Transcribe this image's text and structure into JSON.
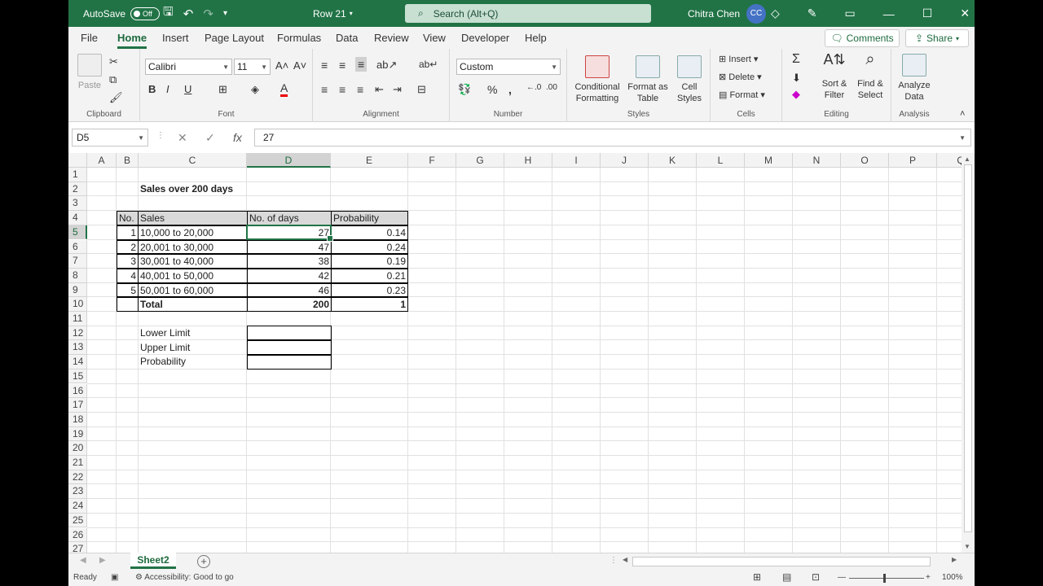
{
  "titlebar": {
    "autosave_label": "AutoSave",
    "autosave_state": "Off",
    "doc_title": "Row 21",
    "search_placeholder": "Search (Alt+Q)",
    "user_name": "Chitra Chen",
    "user_initials": "CC"
  },
  "tabs": [
    "File",
    "Home",
    "Insert",
    "Page Layout",
    "Formulas",
    "Data",
    "Review",
    "View",
    "Developer",
    "Help"
  ],
  "active_tab": "Home",
  "buttons": {
    "comments": "Comments",
    "share": "Share"
  },
  "ribbon": {
    "clipboard": {
      "paste": "Paste",
      "label": "Clipboard"
    },
    "font": {
      "name": "Calibri",
      "size": "11",
      "label": "Font"
    },
    "alignment": {
      "label": "Alignment"
    },
    "number": {
      "format": "Custom",
      "label": "Number"
    },
    "styles": {
      "conditional": "Conditional",
      "conditional2": "Formatting",
      "format_as": "Format as",
      "format_as2": "Table",
      "cell": "Cell",
      "cell2": "Styles",
      "label": "Styles"
    },
    "cells": {
      "insert": "Insert",
      "delete": "Delete",
      "format": "Format",
      "label": "Cells"
    },
    "editing": {
      "sort": "Sort &",
      "sort2": "Filter",
      "find": "Find &",
      "find2": "Select",
      "label": "Editing"
    },
    "analysis": {
      "analyze": "Analyze",
      "analyze2": "Data",
      "label": "Analysis"
    }
  },
  "formula_bar": {
    "name_box": "D5",
    "formula": "27"
  },
  "columns": [
    "A",
    "B",
    "C",
    "D",
    "E",
    "F",
    "G",
    "H",
    "I",
    "J",
    "K",
    "L",
    "M",
    "N",
    "O",
    "P",
    "Q"
  ],
  "rows": [
    "1",
    "2",
    "3",
    "4",
    "5",
    "6",
    "7",
    "8",
    "9",
    "10",
    "11",
    "12",
    "13",
    "14",
    "15",
    "16",
    "17",
    "18",
    "19",
    "20",
    "21",
    "22",
    "23",
    "24",
    "25",
    "26",
    "27"
  ],
  "sheet": {
    "title": "Sales over 200 days",
    "headers": {
      "no": "No.",
      "sales": "Sales",
      "days": "No. of days",
      "prob": "Probability"
    },
    "data": [
      {
        "no": "1",
        "sales": "10,000 to 20,000",
        "days": "27",
        "prob": "0.14"
      },
      {
        "no": "2",
        "sales": "20,001 to 30,000",
        "days": "47",
        "prob": "0.24"
      },
      {
        "no": "3",
        "sales": "30,001 to 40,000",
        "days": "38",
        "prob": "0.19"
      },
      {
        "no": "4",
        "sales": "40,001 to 50,000",
        "days": "42",
        "prob": "0.21"
      },
      {
        "no": "5",
        "sales": "50,001 to 60,000",
        "days": "46",
        "prob": "0.23"
      }
    ],
    "total": {
      "label": "Total",
      "days": "200",
      "prob": "1"
    },
    "lower_limit": "Lower Limit",
    "upper_limit": "Upper Limit",
    "probability": "Probability"
  },
  "sheet_tab": "Sheet2",
  "status": {
    "ready": "Ready",
    "accessibility": "Accessibility: Good to go",
    "zoom": "100%"
  },
  "colors": {
    "accent": "#217346"
  }
}
